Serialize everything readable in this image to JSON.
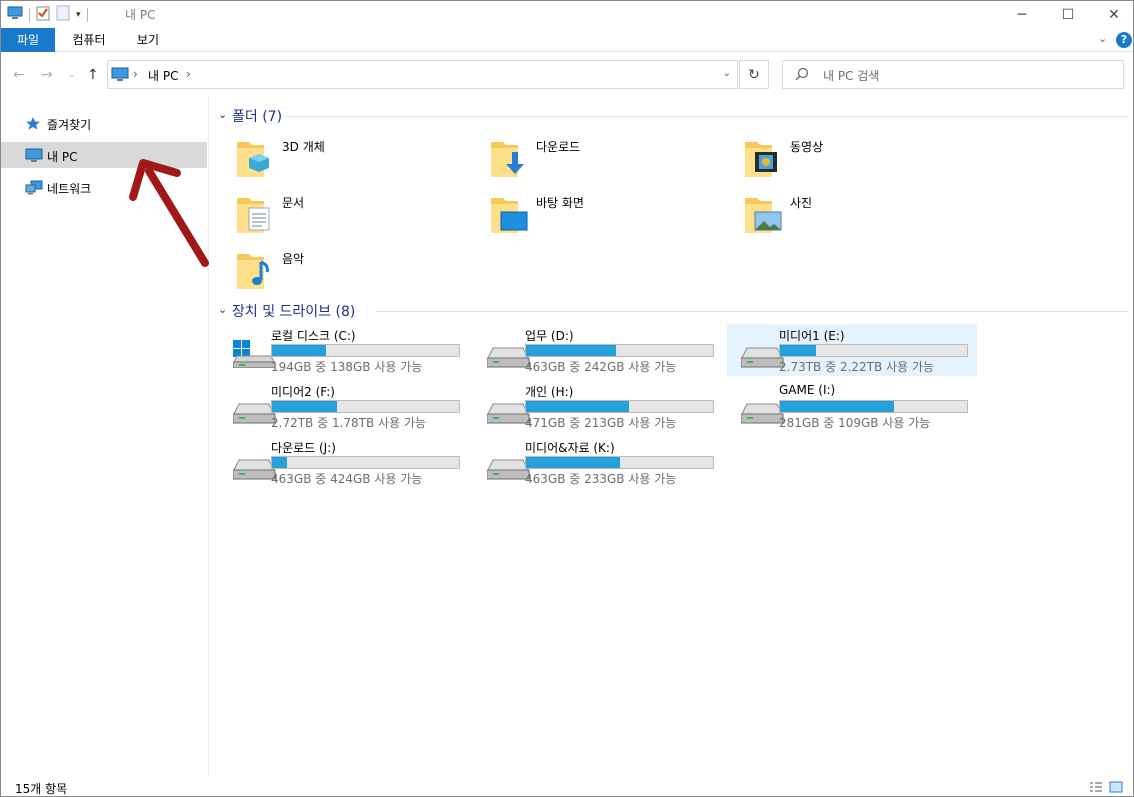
{
  "window": {
    "title": "내 PC"
  },
  "ribbon": {
    "tabs": [
      "파일",
      "컴퓨터",
      "보기"
    ]
  },
  "address": {
    "crumb1": "내 PC",
    "sep": "›"
  },
  "search": {
    "placeholder": "내 PC 검색"
  },
  "nav": {
    "items": [
      {
        "label": "즐겨찾기",
        "icon": "star-icon"
      },
      {
        "label": "내 PC",
        "icon": "computer-icon",
        "selected": true
      },
      {
        "label": "네트워크",
        "icon": "network-icon"
      }
    ]
  },
  "folders": {
    "title": "폴더 (7)",
    "items": [
      {
        "label": "3D 개체",
        "icon": "3d-objects-icon"
      },
      {
        "label": "다운로드",
        "icon": "downloads-icon"
      },
      {
        "label": "동영상",
        "icon": "videos-icon"
      },
      {
        "label": "문서",
        "icon": "documents-icon"
      },
      {
        "label": "바탕 화면",
        "icon": "desktop-icon"
      },
      {
        "label": "사진",
        "icon": "pictures-icon"
      },
      {
        "label": "음악",
        "icon": "music-icon"
      }
    ]
  },
  "drives": {
    "title": "장치 및 드라이브 (8)",
    "items": [
      {
        "name": "로컬 디스크 (C:)",
        "space": "194GB 중 138GB 사용 가능",
        "used": 0.29,
        "os": true
      },
      {
        "name": "업무 (D:)",
        "space": "463GB 중 242GB 사용 가능",
        "used": 0.48
      },
      {
        "name": "미디어1 (E:)",
        "space": "2.73TB 중 2.22TB 사용 가능",
        "used": 0.19,
        "highlight": true
      },
      {
        "name": "미디어2 (F:)",
        "space": "2.72TB 중 1.78TB 사용 가능",
        "used": 0.35
      },
      {
        "name": "개인 (H:)",
        "space": "471GB 중 213GB 사용 가능",
        "used": 0.55
      },
      {
        "name": "GAME (I:)",
        "space": "281GB 중 109GB 사용 가능",
        "used": 0.61
      },
      {
        "name": "다운로드 (J:)",
        "space": "463GB 중 424GB 사용 가능",
        "used": 0.08
      },
      {
        "name": "미디어&자료 (K:)",
        "space": "463GB 중 233GB 사용 가능",
        "used": 0.5
      }
    ]
  },
  "status": {
    "count": "15개 항목"
  },
  "colors": {
    "accent": "#1979ca",
    "bar": "#26a0da",
    "selection": "#d9d9d9",
    "arrow": "#a01818"
  }
}
